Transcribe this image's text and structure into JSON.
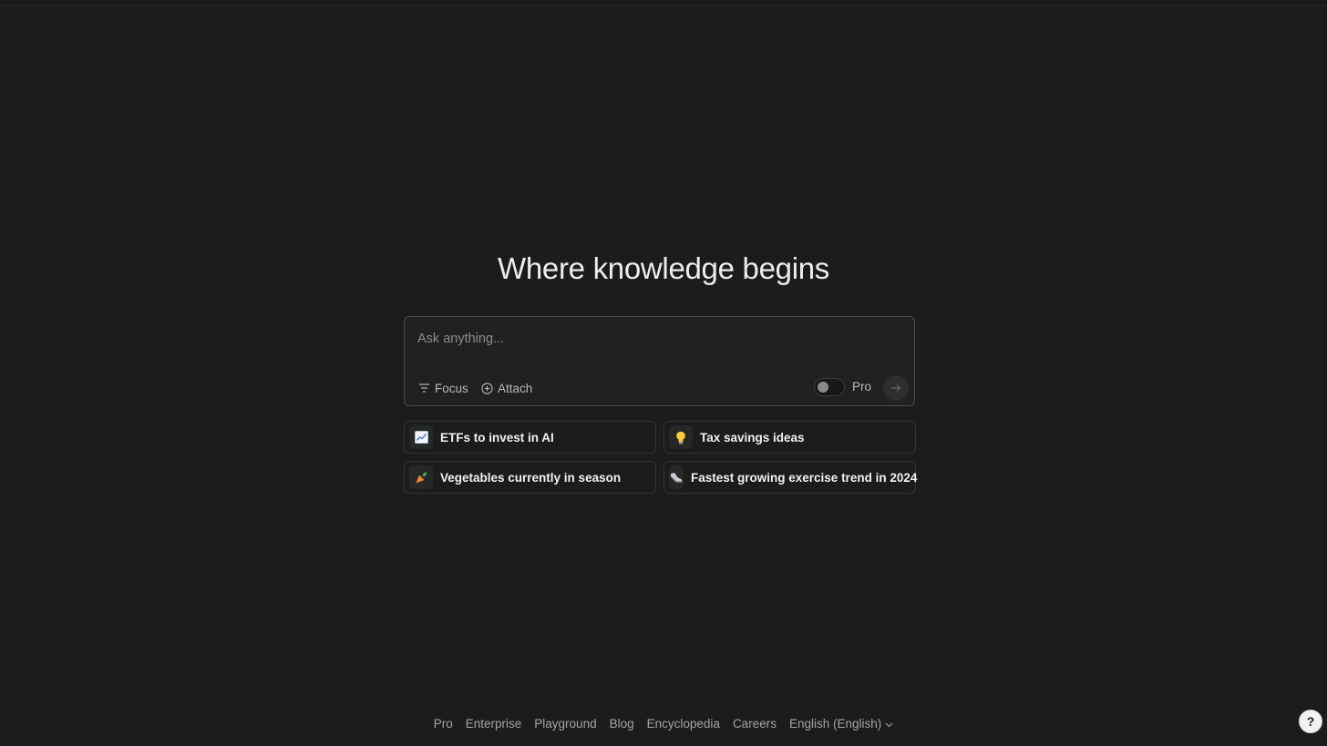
{
  "headline": "Where knowledge begins",
  "search": {
    "placeholder": "Ask anything...",
    "value": "",
    "focus_label": "Focus",
    "attach_label": "Attach",
    "pro_label": "Pro",
    "pro_enabled": false,
    "send_icon": "arrow-right-icon"
  },
  "suggestions": [
    {
      "icon": "chart-increasing-icon",
      "label": "ETFs to invest in AI"
    },
    {
      "icon": "light-bulb-icon",
      "label": "Tax savings ideas"
    },
    {
      "icon": "carrot-icon",
      "label": "Vegetables currently in season"
    },
    {
      "icon": "running-shoe-icon",
      "label": "Fastest growing exercise trend in 2024"
    }
  ],
  "footer": {
    "links": [
      "Pro",
      "Enterprise",
      "Playground",
      "Blog",
      "Encyclopedia",
      "Careers"
    ],
    "language": "English (English)"
  },
  "help": {
    "label": "?"
  },
  "colors": {
    "background": "#1b1c1c",
    "box_border": "#4a4b4b",
    "text_primary": "#ececea",
    "text_muted": "#a5a6a3"
  }
}
